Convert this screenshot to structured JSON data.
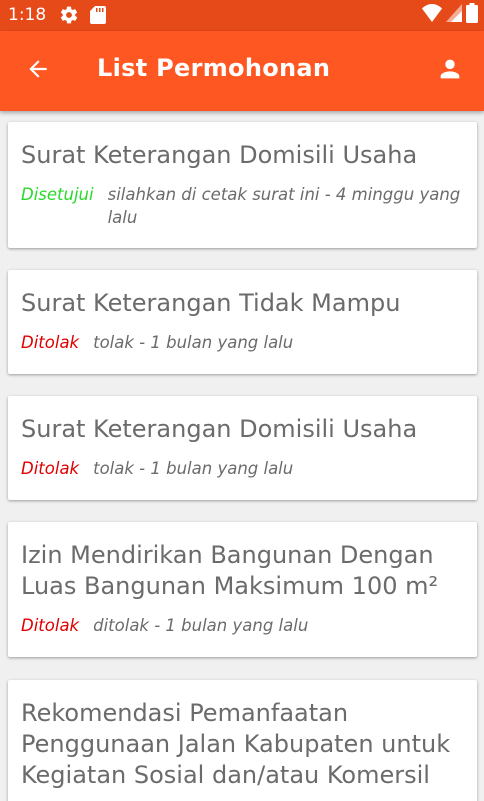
{
  "status_bar": {
    "time": "1:18",
    "icons": [
      "gear-icon",
      "sd-card-icon",
      "wifi-icon",
      "signal-icon",
      "battery-icon"
    ]
  },
  "app_bar": {
    "title": "List Permohonan",
    "back_icon": "arrow-back-icon",
    "account_icon": "account-icon"
  },
  "colors": {
    "status_bar": "#e64a19",
    "app_bar": "#ff5722",
    "approved": "#2bd92b",
    "rejected": "#e00000",
    "text": "#6b6b6b"
  },
  "requests": [
    {
      "title": "Surat Keterangan Domisili Usaha",
      "status": "Disetujui",
      "note": "silahkan di cetak surat ini - 4 minggu yang lalu"
    },
    {
      "title": "Surat Keterangan Tidak Mampu",
      "status": "Ditolak",
      "note": "tolak - 1 bulan yang lalu"
    },
    {
      "title": "Surat Keterangan Domisili Usaha",
      "status": "Ditolak",
      "note": "tolak - 1 bulan yang lalu"
    },
    {
      "title": "Izin Mendirikan Bangunan Dengan Luas Bangunan Maksimum 100 m²",
      "status": "Ditolak",
      "note": "ditolak - 1 bulan yang lalu"
    },
    {
      "title": "Rekomendasi Pemanfaatan Penggunaan Jalan Kabupaten untuk Kegiatan Sosial dan/atau Komersil",
      "status": "",
      "note": ""
    }
  ]
}
